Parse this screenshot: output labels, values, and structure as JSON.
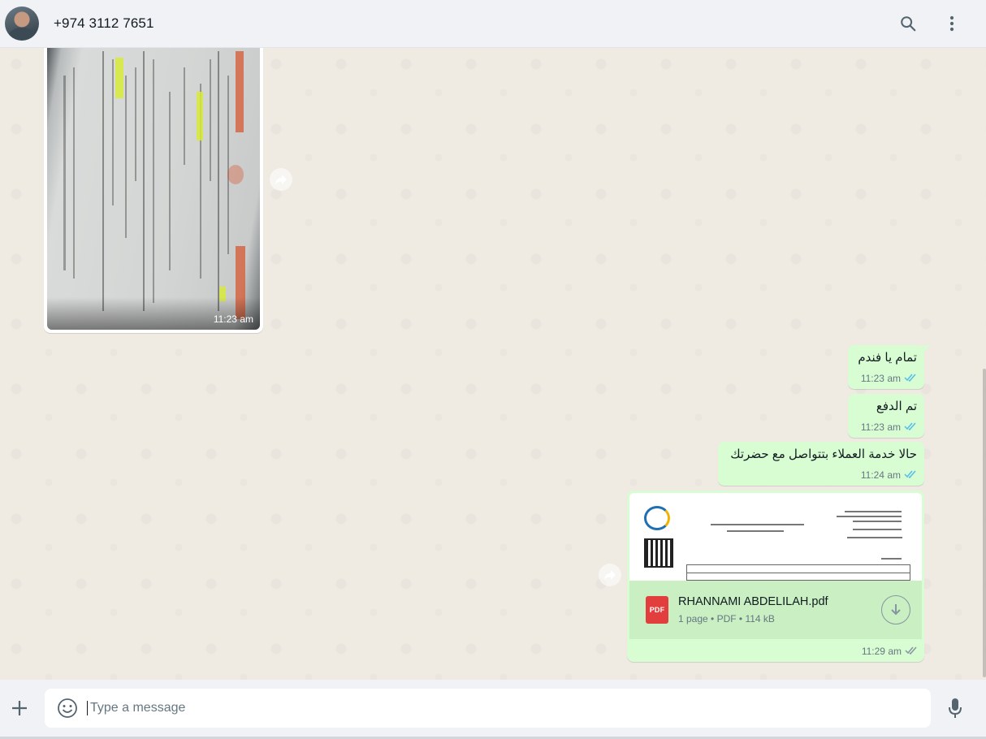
{
  "header": {
    "contact_name": "+974 3112 7651",
    "avatar_icon": "contact-avatar",
    "search_icon": "search-icon",
    "menu_icon": "more-vertical-icon"
  },
  "messages": {
    "incoming_image": {
      "time": "11:23 am"
    },
    "outgoing": [
      {
        "text": "تمام يا فندم",
        "time": "11:23 am",
        "status": "read"
      },
      {
        "text": "تم الدفع",
        "time": "11:23 am",
        "status": "read"
      },
      {
        "text": "حالا خدمة العملاء بتتواصل مع حضرتك",
        "time": "11:24 am",
        "status": "read"
      }
    ],
    "document": {
      "file_name": "RHANNAMI ABDELILAH.pdf",
      "details": "1 page • PDF • 114 kB",
      "type_badge": "PDF",
      "time": "11:29 am",
      "status": "delivered"
    }
  },
  "composer": {
    "placeholder": "Type a message"
  },
  "colors": {
    "outgoing_bubble": "#d9fdd3",
    "read_ticks": "#53bdeb",
    "pdf_red": "#e33e3e"
  }
}
